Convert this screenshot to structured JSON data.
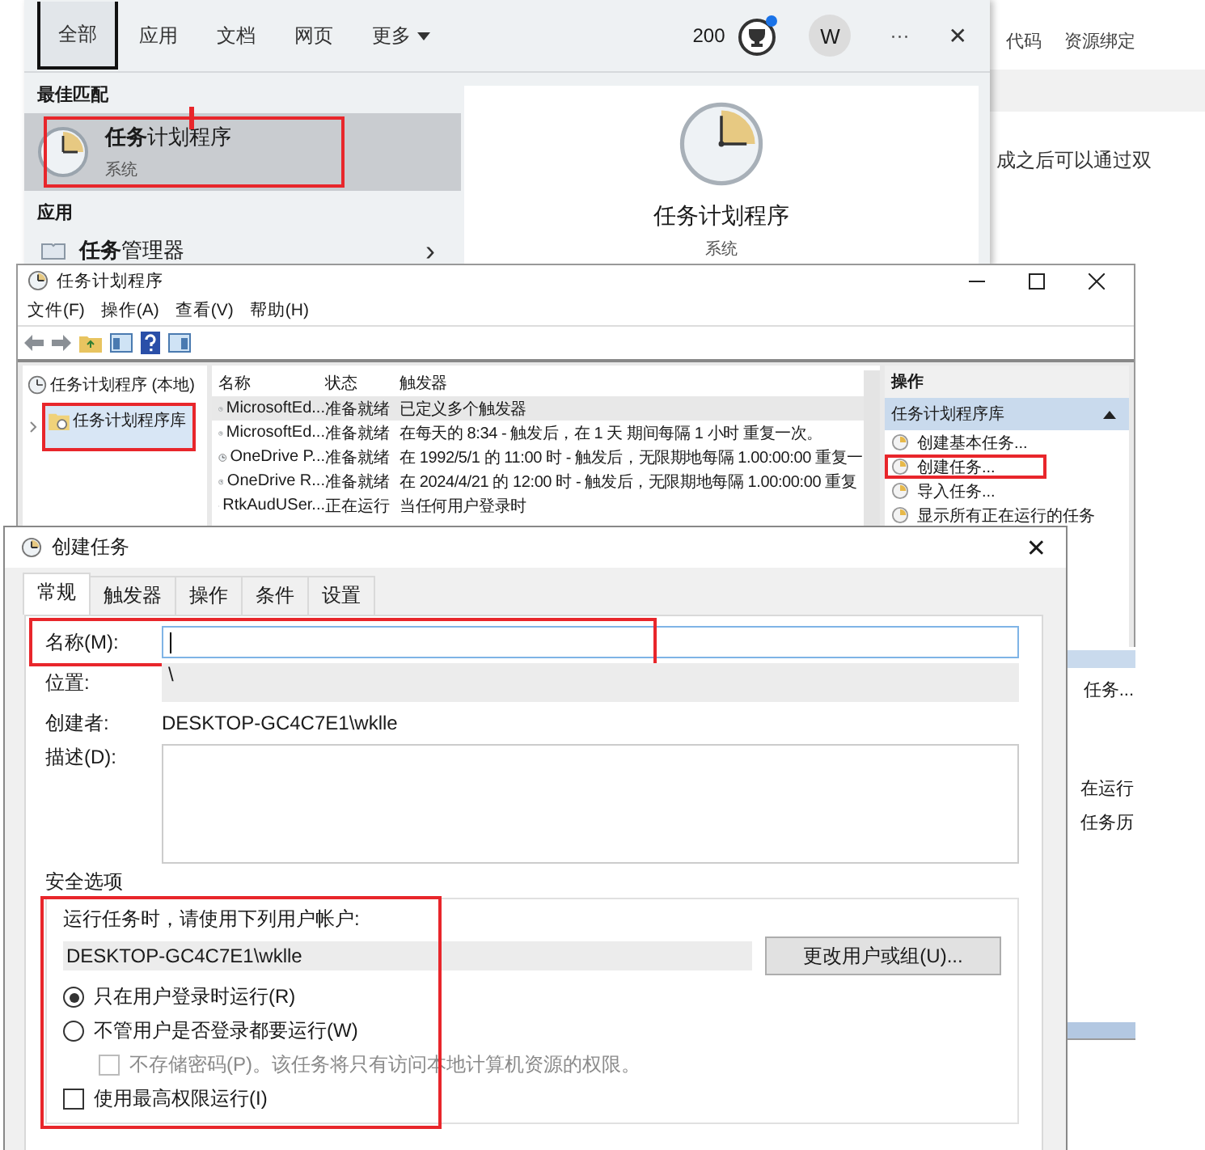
{
  "search_panel": {
    "tabs": [
      {
        "label": "全部",
        "selected": true
      },
      {
        "label": "应用",
        "selected": false
      },
      {
        "label": "文档",
        "selected": false
      },
      {
        "label": "网页",
        "selected": false
      },
      {
        "label": "更多",
        "selected": false
      }
    ],
    "points": "200",
    "avatar": "W",
    "more_menu": "···",
    "close": "✕",
    "best_match_heading": "最佳匹配",
    "best_match": {
      "title": "**任务**计划程序",
      "subtitle": "系统",
      "selected": true,
      "highlighted": true
    },
    "apps_heading": "应用",
    "apps": [
      {
        "title": "**任务**管理器",
        "arrow": "›"
      }
    ],
    "preview": {
      "title": "任务计划程序",
      "subtitle": "系统"
    }
  },
  "background_page": {
    "toolbar": [
      "代码",
      "资源绑定"
    ],
    "text": "成之后可以通过双"
  },
  "scheduler": {
    "title": "任务计划程序",
    "menu": [
      "文件(F)",
      "操作(A)",
      "查看(V)",
      "帮助(H)"
    ],
    "tree": [
      {
        "label": "任务计划程序 (本地)",
        "selected": false,
        "highlighted": false,
        "children": [
          {
            "label": "任务计划程序库",
            "selected": true,
            "highlighted": true
          }
        ]
      }
    ],
    "columns": [
      "名称",
      "状态",
      "触发器"
    ],
    "rows": [
      {
        "name": "MicrosoftEd...",
        "status": "准备就绪",
        "trigger": "已定义多个触发器",
        "selected": true
      },
      {
        "name": "MicrosoftEd...",
        "status": "准备就绪",
        "trigger": "在每天的 8:34 - 触发后，在 1 天 期间每隔 1 小时 重复一次。",
        "selected": false
      },
      {
        "name": "OneDrive P...",
        "status": "准备就绪",
        "trigger": "在 1992/5/1 的 11:00 时 - 触发后，无限期地每隔 1.00:00:00 重复一",
        "selected": false
      },
      {
        "name": "OneDrive R...",
        "status": "准备就绪",
        "trigger": "在 2024/4/21 的 12:00 时 - 触发后，无限期地每隔 1.00:00:00 重复",
        "selected": false
      },
      {
        "name": "RtkAudUSer...",
        "status": "正在运行",
        "trigger": "当任何用户登录时",
        "selected": false
      }
    ],
    "actions_heading": "操作",
    "actions_section": "任务计划程序库",
    "actions": [
      {
        "label": "创建基本任务...",
        "highlighted": false
      },
      {
        "label": "创建任务...",
        "highlighted": true
      },
      {
        "label": "导入任务...",
        "highlighted": false
      },
      {
        "label": "显示所有正在运行的任务",
        "highlighted": false
      }
    ],
    "actions_lower": [
      "任务...",
      "在运行",
      "任务历"
    ]
  },
  "dialog": {
    "title": "创建任务",
    "close": "✕",
    "tabs": [
      {
        "label": "常规",
        "selected": true
      },
      {
        "label": "触发器",
        "selected": false
      },
      {
        "label": "操作",
        "selected": false
      },
      {
        "label": "条件",
        "selected": false
      },
      {
        "label": "设置",
        "selected": false
      }
    ],
    "name_label": "名称(M):",
    "name_highlighted": true,
    "location_label": "位置:",
    "location": "\\",
    "author_label": "创建者:",
    "author": "DESKTOP-GC4C7E1\\wklle",
    "description_label": "描述(D):",
    "security": {
      "heading": "安全选项",
      "highlighted": true,
      "prompt": "运行任务时，请使用下列用户帐户:",
      "account": "DESKTOP-GC4C7E1\\wklle",
      "change_button": "更改用户或组(U)...",
      "options": [
        {
          "kind": "radio",
          "label": "只在用户登录时运行(R)",
          "selected": true,
          "disabled": false
        },
        {
          "kind": "radio",
          "label": "不管用户是否登录都要运行(W)",
          "selected": false,
          "disabled": false
        },
        {
          "kind": "sub_checkbox",
          "label": "不存储密码(P)。该任务将只有访问本地计算机资源的权限。",
          "checked": false,
          "disabled": true
        },
        {
          "kind": "checkbox",
          "label": "使用最高权限运行(I)",
          "checked": false,
          "disabled": false
        }
      ]
    }
  }
}
